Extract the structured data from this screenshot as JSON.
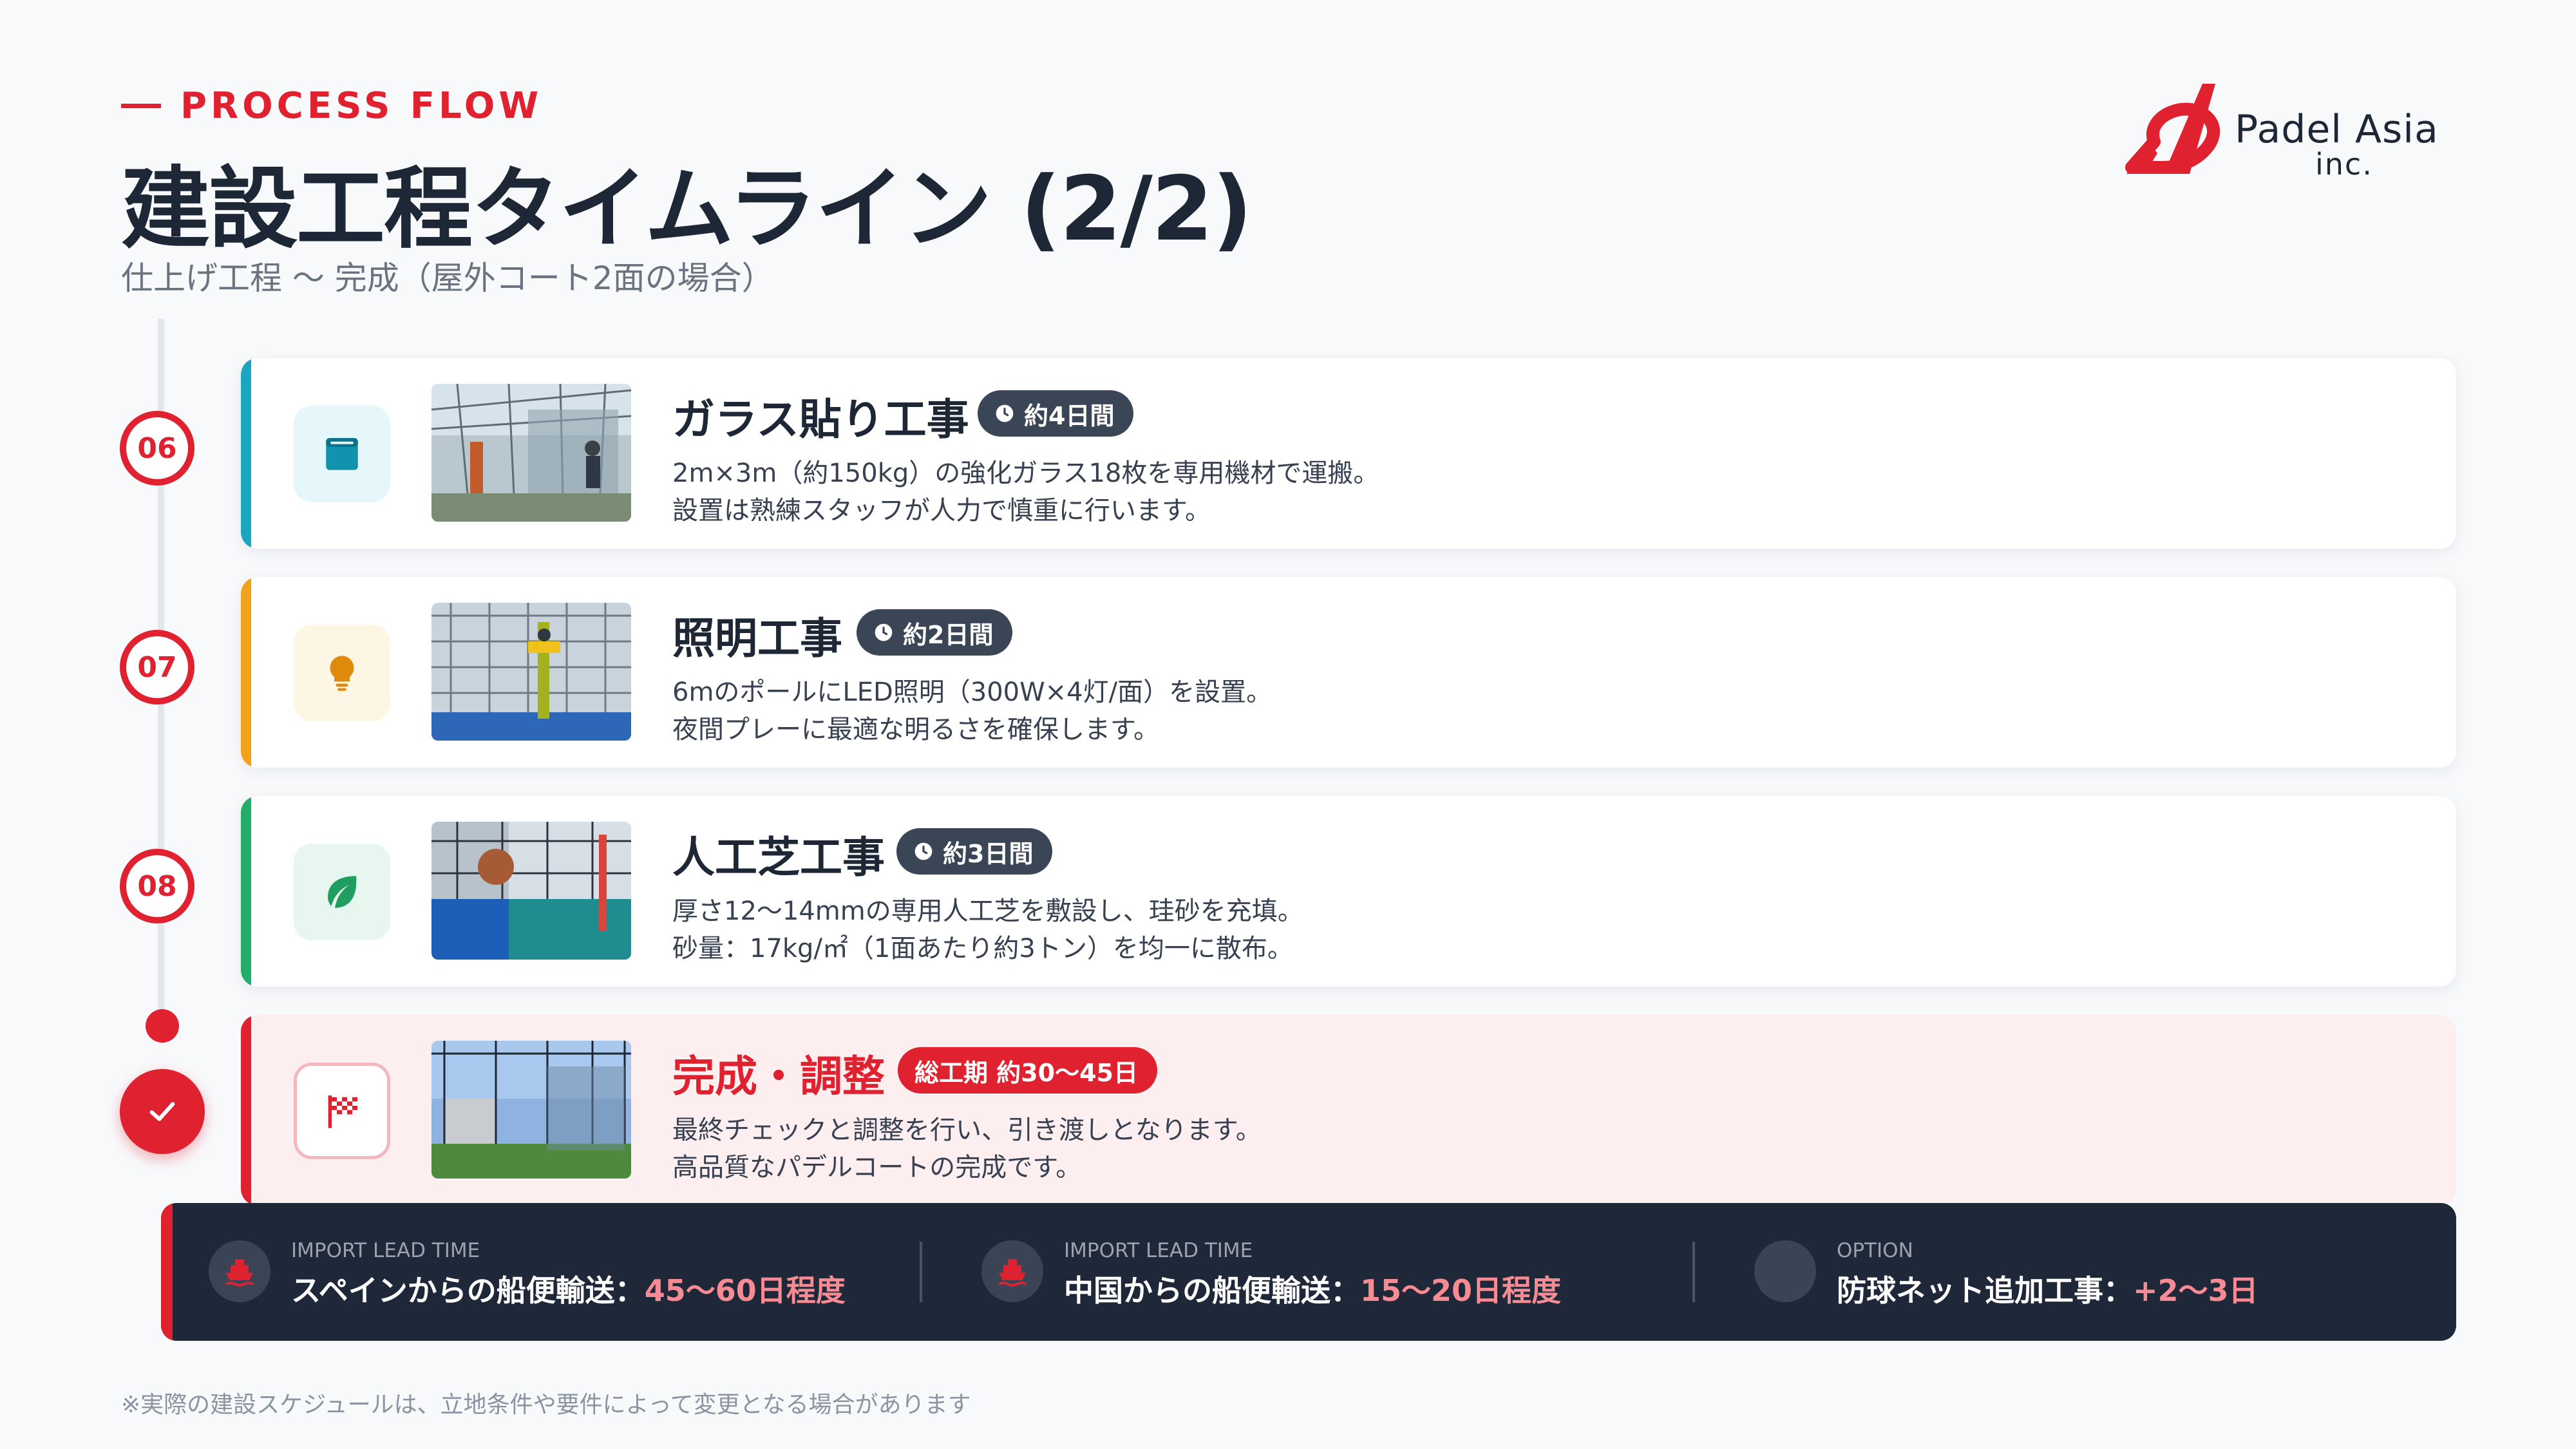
{
  "header": {
    "eyebrow": "PROCESS FLOW",
    "title": "建設工程タイムライン (2/2)",
    "subtitle": "仕上げ工程 〜 完成（屋外コート2面の場合）"
  },
  "logo": {
    "name": "Padel Asia",
    "suffix": "inc."
  },
  "colors": {
    "accent_red": "#e02130",
    "teal": "#1aa5c0",
    "amber": "#f0a21a",
    "green": "#22ad6b",
    "navy": "#1f2838"
  },
  "steps": [
    {
      "number": "06",
      "title": "ガラス貼り工事",
      "duration": "約4日間",
      "icon": "window-icon",
      "desc_line1": "2m×3m（約150kg）の強化ガラス18枚を専用機材で運搬。",
      "desc_line2": "設置は熟練スタッフが人力で慎重に行います。"
    },
    {
      "number": "07",
      "title": "照明工事",
      "duration": "約2日間",
      "icon": "lightbulb-icon",
      "desc_line1": "6mのポールにLED照明（300W×4灯/面）を設置。",
      "desc_line2": "夜間プレーに最適な明るさを確保します。"
    },
    {
      "number": "08",
      "title": "人工芝工事",
      "duration": "約3日間",
      "icon": "leaf-icon",
      "desc_line1": "厚さ12〜14mmの専用人工芝を敷設し、珪砂を充填。",
      "desc_line2": "砂量：17kg/㎡（1面あたり約3トン）を均一に散布。"
    }
  ],
  "final_step": {
    "title": "完成・調整",
    "badge": "総工期 約30〜45日",
    "icon": "checkered-flag-icon",
    "desc_line1": "最終チェックと調整を行い、引き渡しとなります。",
    "desc_line2": "高品質なパデルコートの完成です。"
  },
  "info_bar": [
    {
      "label": "IMPORT LEAD TIME",
      "text": "スペインからの船便輸送：",
      "highlight": "45〜60日程度",
      "icon": "ship-icon"
    },
    {
      "label": "IMPORT LEAD TIME",
      "text": "中国からの船便輸送：",
      "highlight": "15〜20日程度",
      "icon": "ship-icon"
    },
    {
      "label": "OPTION",
      "text": "防球ネット追加工事：",
      "highlight": "+2〜3日",
      "icon": "net-icon"
    }
  ],
  "footnote": "※実際の建設スケジュールは、立地条件や要件によって変更となる場合があります"
}
